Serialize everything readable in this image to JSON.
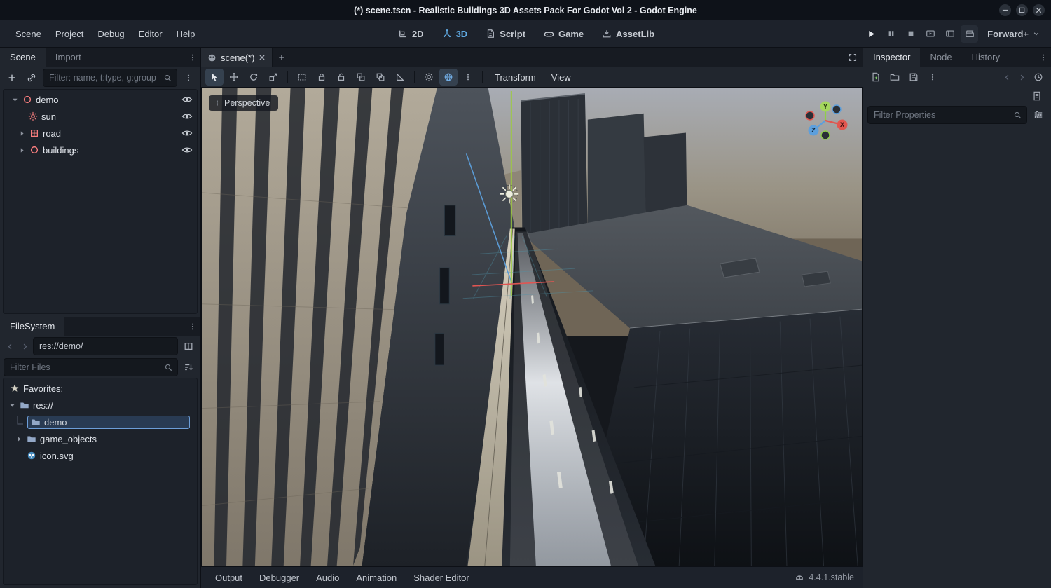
{
  "colors": {
    "accent": "#5fa8e0",
    "selection_border": "#6d9ed8",
    "node3d_icon": "#fc7f7f",
    "panel_bg": "#21262e",
    "recess_bg": "#1d222a"
  },
  "titlebar": {
    "title": "(*) scene.tscn - Realistic Buildings 3D Assets Pack For Godot Vol 2 - Godot Engine"
  },
  "menubar": {
    "items": [
      {
        "label": "Scene"
      },
      {
        "label": "Project"
      },
      {
        "label": "Debug"
      },
      {
        "label": "Editor"
      },
      {
        "label": "Help"
      }
    ]
  },
  "workspaces": {
    "active": "3D",
    "items": [
      {
        "label": "2D"
      },
      {
        "label": "3D"
      },
      {
        "label": "Script"
      },
      {
        "label": "Game"
      },
      {
        "label": "AssetLib"
      }
    ]
  },
  "playbar": {
    "renderer": "Forward+"
  },
  "scene_dock": {
    "tabs": [
      {
        "label": "Scene"
      },
      {
        "label": "Import"
      }
    ],
    "filter_placeholder": "Filter: name, t:type, g:group",
    "tree": [
      {
        "label": "demo",
        "type": "Node3D",
        "depth": 0,
        "expanded": true,
        "visible": true
      },
      {
        "label": "sun",
        "type": "DirectionalLight3D",
        "depth": 1,
        "visible": true
      },
      {
        "label": "road",
        "type": "MeshInstance3D",
        "depth": 1,
        "collapsed": true,
        "visible": true
      },
      {
        "label": "buildings",
        "type": "Node3D",
        "depth": 1,
        "collapsed": true,
        "visible": true
      }
    ]
  },
  "filesystem_dock": {
    "title": "FileSystem",
    "path": "res://demo/",
    "filter_placeholder": "Filter Files",
    "tree": [
      {
        "label": "Favorites:",
        "icon": "star"
      },
      {
        "label": "res://",
        "icon": "folder",
        "expanded": true
      },
      {
        "label": "demo",
        "icon": "folder",
        "selected": true
      },
      {
        "label": "game_objects",
        "icon": "folder",
        "collapsed": true
      },
      {
        "label": "icon.svg",
        "icon": "godot"
      }
    ]
  },
  "viewport": {
    "tab_label": "scene(*)",
    "perspective_label": "Perspective",
    "menus": [
      {
        "label": "Transform"
      },
      {
        "label": "View"
      }
    ],
    "gizmo": {
      "x": "X",
      "y": "Y",
      "z": "Z"
    }
  },
  "inspector_dock": {
    "tabs": [
      {
        "label": "Inspector"
      },
      {
        "label": "Node"
      },
      {
        "label": "History"
      }
    ],
    "filter_placeholder": "Filter Properties"
  },
  "bottom_bar": {
    "items": [
      {
        "label": "Output"
      },
      {
        "label": "Debugger"
      },
      {
        "label": "Audio"
      },
      {
        "label": "Animation"
      },
      {
        "label": "Shader Editor"
      }
    ],
    "version": "4.4.1.stable"
  }
}
